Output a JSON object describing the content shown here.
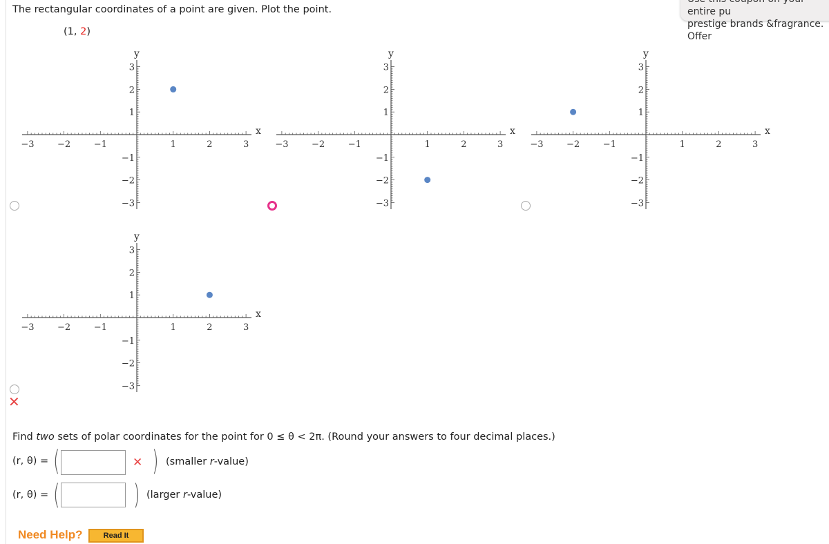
{
  "question": {
    "prompt": "The rectangular coordinates of a point are given. Plot the point.",
    "point_open": "(1, ",
    "point_y": "2",
    "point_close": ")"
  },
  "options": [
    {
      "x": 1,
      "y": 2,
      "selected": false
    },
    {
      "x": 1,
      "y": -2,
      "selected": true
    },
    {
      "x": -2,
      "y": 1,
      "selected": false
    },
    {
      "x": 2,
      "y": 1,
      "selected": false
    }
  ],
  "axis": {
    "x_label": "x",
    "y_label": "y",
    "ticks": [
      "−3",
      "−2",
      "−1",
      "1",
      "2",
      "3"
    ],
    "range": [
      -3,
      3
    ]
  },
  "point_color": "#5a86c5",
  "status": {
    "plot_result": "incorrect"
  },
  "part2": {
    "text_before": "Find ",
    "text_em": "two",
    "text_after": " sets of polar coordinates for the point for 0 ≤ θ < 2π. (Round your answers to four decimal places.)",
    "rows": [
      {
        "label": "(r, θ)  =",
        "value": "",
        "note_before": "(smaller ",
        "note_r": "r",
        "note_after": "-value)",
        "status": "incorrect"
      },
      {
        "label": "(r, θ)  =",
        "value": "",
        "note_before": "(larger ",
        "note_r": "r",
        "note_after": "-value)",
        "status": ""
      }
    ]
  },
  "help": {
    "label": "Need Help?",
    "read_it": "Read It"
  },
  "popup": {
    "line1": "Use this coupon on your entire pu",
    "line2": "prestige brands &fragrance. Offer"
  }
}
